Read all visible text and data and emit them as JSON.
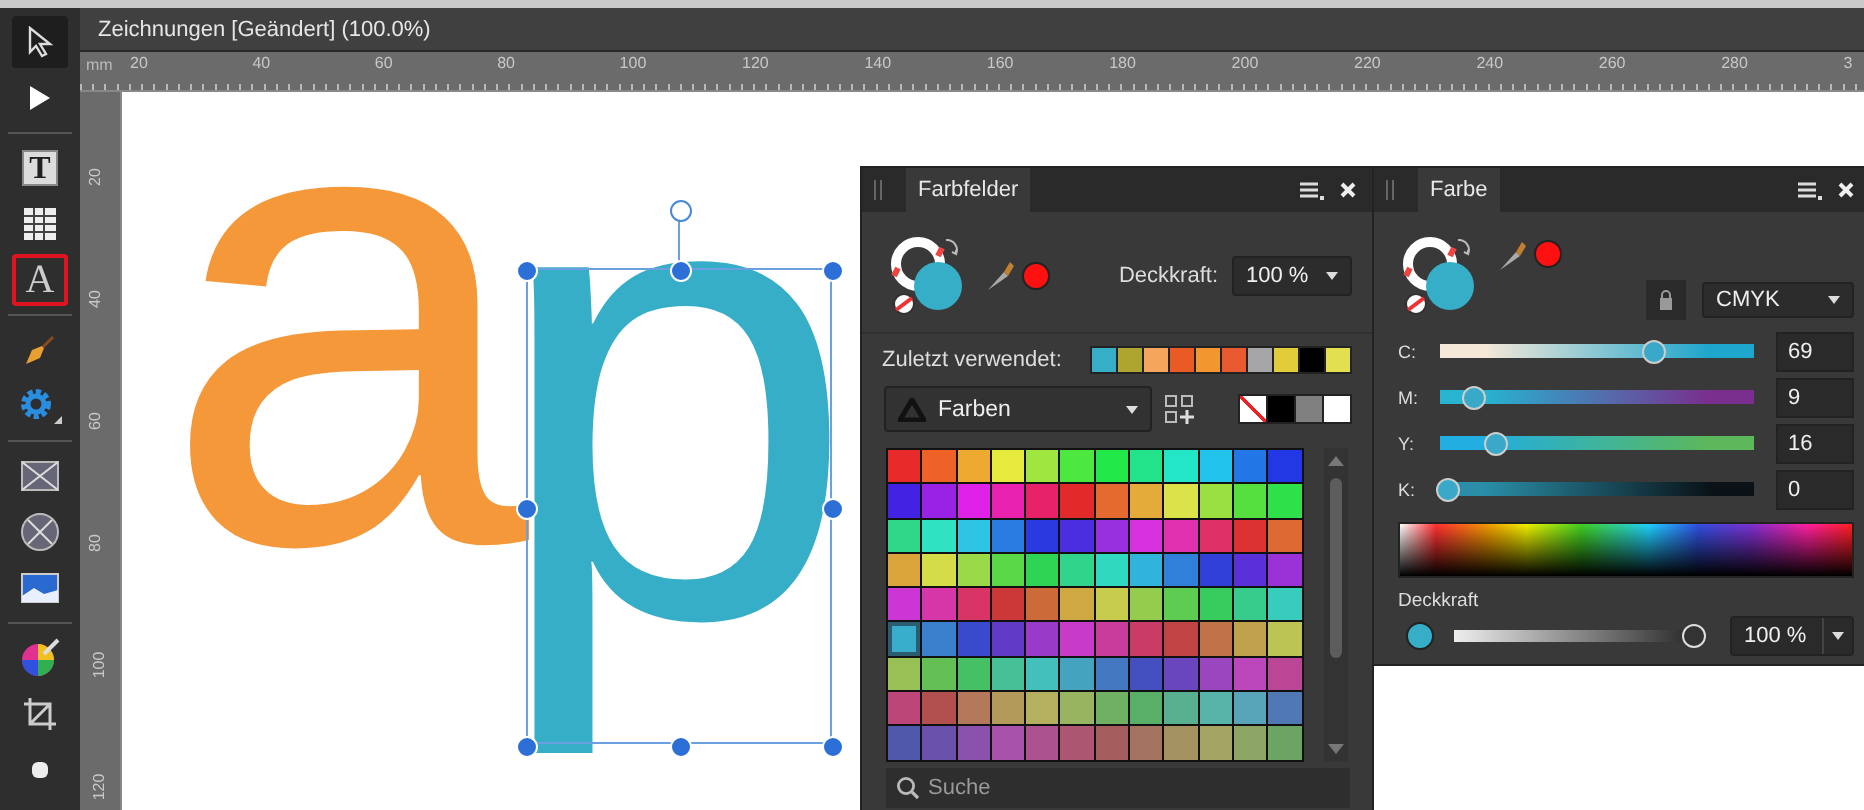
{
  "window": {
    "title": "Zeichnungen [Geändert] (100.0%)"
  },
  "tools": [
    {
      "kind": "move",
      "selected": true,
      "highlighted": false,
      "separator_after": false
    },
    {
      "kind": "node",
      "selected": false,
      "highlighted": false,
      "separator_after": true
    },
    {
      "kind": "frame-text",
      "label": "T",
      "selected": false,
      "highlighted": false,
      "separator_after": false
    },
    {
      "kind": "table",
      "selected": false,
      "highlighted": false,
      "separator_after": false
    },
    {
      "kind": "artistic-text",
      "label": "A",
      "selected": false,
      "highlighted": true,
      "separator_after": true
    },
    {
      "kind": "pen",
      "selected": false,
      "highlighted": false,
      "separator_after": false
    },
    {
      "kind": "gear",
      "selected": false,
      "highlighted": false,
      "separator_after": true
    },
    {
      "kind": "rect-placeholder",
      "selected": false,
      "highlighted": false,
      "separator_after": false
    },
    {
      "kind": "ellipse-placeholder",
      "selected": false,
      "highlighted": false,
      "separator_after": false
    },
    {
      "kind": "image",
      "selected": false,
      "highlighted": false,
      "separator_after": true
    },
    {
      "kind": "color-wheel",
      "selected": false,
      "highlighted": false,
      "separator_after": false
    },
    {
      "kind": "crop",
      "selected": false,
      "highlighted": false,
      "separator_after": false
    },
    {
      "kind": "pill",
      "selected": false,
      "highlighted": false,
      "separator_after": false
    }
  ],
  "ruler": {
    "unit": "mm",
    "top_labels": [
      "20",
      "40",
      "60",
      "80",
      "100",
      "120",
      "140",
      "160",
      "180",
      "200",
      "220",
      "240",
      "260",
      "280",
      "3"
    ],
    "side_labels": [
      "20",
      "40",
      "60",
      "80",
      "100",
      "120"
    ]
  },
  "canvas": {
    "letters": [
      {
        "text": "a",
        "color": "#f4983a",
        "selected": false
      },
      {
        "text": "p",
        "color": "#37aec8",
        "selected": true
      }
    ]
  },
  "swatches_panel": {
    "tab": "Farbfelder",
    "fill": {
      "color": "#37aec8"
    },
    "picked": {
      "color": "#ff1010"
    },
    "opacity_label": "Deckkraft:",
    "opacity_value": "100 %",
    "recent_label": "Zuletzt verwendet:",
    "recent": [
      {
        "color": "#37aec8"
      },
      {
        "color": "#aea52e"
      },
      {
        "color": "#f6a65c"
      },
      {
        "color": "#ea5a24"
      },
      {
        "color": "#f29630"
      },
      {
        "color": "#ea5a30"
      },
      {
        "color": "#a6a6a8"
      },
      {
        "color": "#e2cc3a"
      },
      {
        "color": "#000000"
      },
      {
        "color": "#e2e050"
      }
    ],
    "palette": "Farben",
    "quick": [
      {
        "kind": "none"
      },
      {
        "kind": "color",
        "color": "#000000"
      },
      {
        "kind": "color",
        "color": "#808080"
      },
      {
        "kind": "color",
        "color": "#ffffff"
      }
    ],
    "swatches": [
      {
        "color": "#e82a2a",
        "selected": false
      },
      {
        "color": "#ee6228",
        "selected": false
      },
      {
        "color": "#eeaa30",
        "selected": false
      },
      {
        "color": "#e6ea3c",
        "selected": false
      },
      {
        "color": "#a0e640",
        "selected": false
      },
      {
        "color": "#4ce840",
        "selected": false
      },
      {
        "color": "#22e84a",
        "selected": false
      },
      {
        "color": "#22e28a",
        "selected": false
      },
      {
        "color": "#22e6c6",
        "selected": false
      },
      {
        "color": "#22c4ec",
        "selected": false
      },
      {
        "color": "#2276e6",
        "selected": false
      },
      {
        "color": "#2238e4",
        "selected": false
      },
      {
        "color": "#4422e4",
        "selected": false
      },
      {
        "color": "#9a22e4",
        "selected": false
      },
      {
        "color": "#e022e8",
        "selected": false
      },
      {
        "color": "#ea22b0",
        "selected": false
      },
      {
        "color": "#e82268",
        "selected": false
      },
      {
        "color": "#e22a2a",
        "selected": false
      },
      {
        "color": "#e46a30",
        "selected": false
      },
      {
        "color": "#e4aa3a",
        "selected": false
      },
      {
        "color": "#dce24a",
        "selected": false
      },
      {
        "color": "#9ae040",
        "selected": false
      },
      {
        "color": "#56e040",
        "selected": false
      },
      {
        "color": "#2ee04a",
        "selected": false
      },
      {
        "color": "#2ed888",
        "selected": false
      },
      {
        "color": "#2ee2c2",
        "selected": false
      },
      {
        "color": "#2ec4e4",
        "selected": false
      },
      {
        "color": "#2a7ce2",
        "selected": false
      },
      {
        "color": "#2a3ae0",
        "selected": false
      },
      {
        "color": "#4a2ee0",
        "selected": false
      },
      {
        "color": "#9830e0",
        "selected": false
      },
      {
        "color": "#d832e0",
        "selected": false
      },
      {
        "color": "#e032b0",
        "selected": false
      },
      {
        "color": "#e03068",
        "selected": false
      },
      {
        "color": "#dc3232",
        "selected": false
      },
      {
        "color": "#dc6a32",
        "selected": false
      },
      {
        "color": "#daa43a",
        "selected": false
      },
      {
        "color": "#d4dc48",
        "selected": false
      },
      {
        "color": "#9ada48",
        "selected": false
      },
      {
        "color": "#5ad848",
        "selected": false
      },
      {
        "color": "#2ed454",
        "selected": false
      },
      {
        "color": "#30d48a",
        "selected": false
      },
      {
        "color": "#30d8c0",
        "selected": false
      },
      {
        "color": "#30b4dc",
        "selected": false
      },
      {
        "color": "#3080da",
        "selected": false
      },
      {
        "color": "#3040d8",
        "selected": false
      },
      {
        "color": "#5a30d8",
        "selected": false
      },
      {
        "color": "#9a32d8",
        "selected": false
      },
      {
        "color": "#cc36d4",
        "selected": false
      },
      {
        "color": "#d636a8",
        "selected": false
      },
      {
        "color": "#d83466",
        "selected": false
      },
      {
        "color": "#cc3838",
        "selected": false
      },
      {
        "color": "#cc6a3a",
        "selected": false
      },
      {
        "color": "#cea840",
        "selected": false
      },
      {
        "color": "#c8cc4c",
        "selected": false
      },
      {
        "color": "#96cc4e",
        "selected": false
      },
      {
        "color": "#5ecc50",
        "selected": false
      },
      {
        "color": "#38cc5e",
        "selected": false
      },
      {
        "color": "#38cc8c",
        "selected": false
      },
      {
        "color": "#38ccbc",
        "selected": false
      },
      {
        "color": "#38aecc",
        "selected": true
      },
      {
        "color": "#3a80cc",
        "selected": false
      },
      {
        "color": "#3a4acc",
        "selected": false
      },
      {
        "color": "#623ac8",
        "selected": false
      },
      {
        "color": "#9a3ac8",
        "selected": false
      },
      {
        "color": "#c83ac8",
        "selected": false
      },
      {
        "color": "#c83c9c",
        "selected": false
      },
      {
        "color": "#c83c66",
        "selected": false
      },
      {
        "color": "#c04444",
        "selected": false
      },
      {
        "color": "#c07248",
        "selected": false
      },
      {
        "color": "#c0a24c",
        "selected": false
      },
      {
        "color": "#bcc454",
        "selected": false
      },
      {
        "color": "#98c054",
        "selected": false
      },
      {
        "color": "#64c054",
        "selected": false
      },
      {
        "color": "#46c064",
        "selected": false
      },
      {
        "color": "#46c096",
        "selected": false
      },
      {
        "color": "#44c0bc",
        "selected": false
      },
      {
        "color": "#44a4c0",
        "selected": false
      },
      {
        "color": "#4478c0",
        "selected": false
      },
      {
        "color": "#4450c0",
        "selected": false
      },
      {
        "color": "#6a46be",
        "selected": false
      },
      {
        "color": "#9a46be",
        "selected": false
      },
      {
        "color": "#bc46bc",
        "selected": false
      },
      {
        "color": "#bc4696",
        "selected": false
      },
      {
        "color": "#bc4678",
        "selected": false
      },
      {
        "color": "#b25050",
        "selected": false
      },
      {
        "color": "#b4785a",
        "selected": false
      },
      {
        "color": "#b49a5a",
        "selected": false
      },
      {
        "color": "#b4b060",
        "selected": false
      },
      {
        "color": "#98b460",
        "selected": false
      },
      {
        "color": "#70b062",
        "selected": false
      },
      {
        "color": "#58b068",
        "selected": false
      },
      {
        "color": "#58b090",
        "selected": false
      },
      {
        "color": "#58b4a8",
        "selected": false
      },
      {
        "color": "#58a4b8",
        "selected": false
      },
      {
        "color": "#5078b4",
        "selected": false
      },
      {
        "color": "#5058ac",
        "selected": false
      },
      {
        "color": "#6a52ac",
        "selected": false
      },
      {
        "color": "#8a52ac",
        "selected": false
      },
      {
        "color": "#a852ac",
        "selected": false
      },
      {
        "color": "#ac528e",
        "selected": false
      },
      {
        "color": "#ac5672",
        "selected": false
      },
      {
        "color": "#a45c5c",
        "selected": false
      },
      {
        "color": "#a47460",
        "selected": false
      },
      {
        "color": "#a49260",
        "selected": false
      },
      {
        "color": "#a4a464",
        "selected": false
      },
      {
        "color": "#8ca464",
        "selected": false
      },
      {
        "color": "#6ca464",
        "selected": false
      }
    ],
    "search_placeholder": "Suche"
  },
  "color_panel": {
    "tab": "Farbe",
    "fill": {
      "color": "#37aec8"
    },
    "picked": {
      "color": "#ff1010"
    },
    "model": "CMYK",
    "channels": [
      {
        "label": "C:",
        "value": "69",
        "level": 0.69,
        "stops": [
          {
            "color": "#f6e8d8"
          },
          {
            "color": "#1ea6cc"
          }
        ]
      },
      {
        "label": "M:",
        "value": "9",
        "level": 0.09,
        "stops": [
          {
            "color": "#26b4d0"
          },
          {
            "color": "#7a2e8e"
          }
        ]
      },
      {
        "label": "Y:",
        "value": "16",
        "level": 0.16,
        "stops": [
          {
            "color": "#22aee0"
          },
          {
            "color": "#5cb85a"
          }
        ]
      },
      {
        "label": "K:",
        "value": "0",
        "level": 0,
        "stops": [
          {
            "color": "#2a8ea8"
          },
          {
            "color": "#0a1218"
          }
        ]
      }
    ],
    "opacity": {
      "label": "Deckkraft",
      "value": "100 %",
      "level": 1
    }
  }
}
